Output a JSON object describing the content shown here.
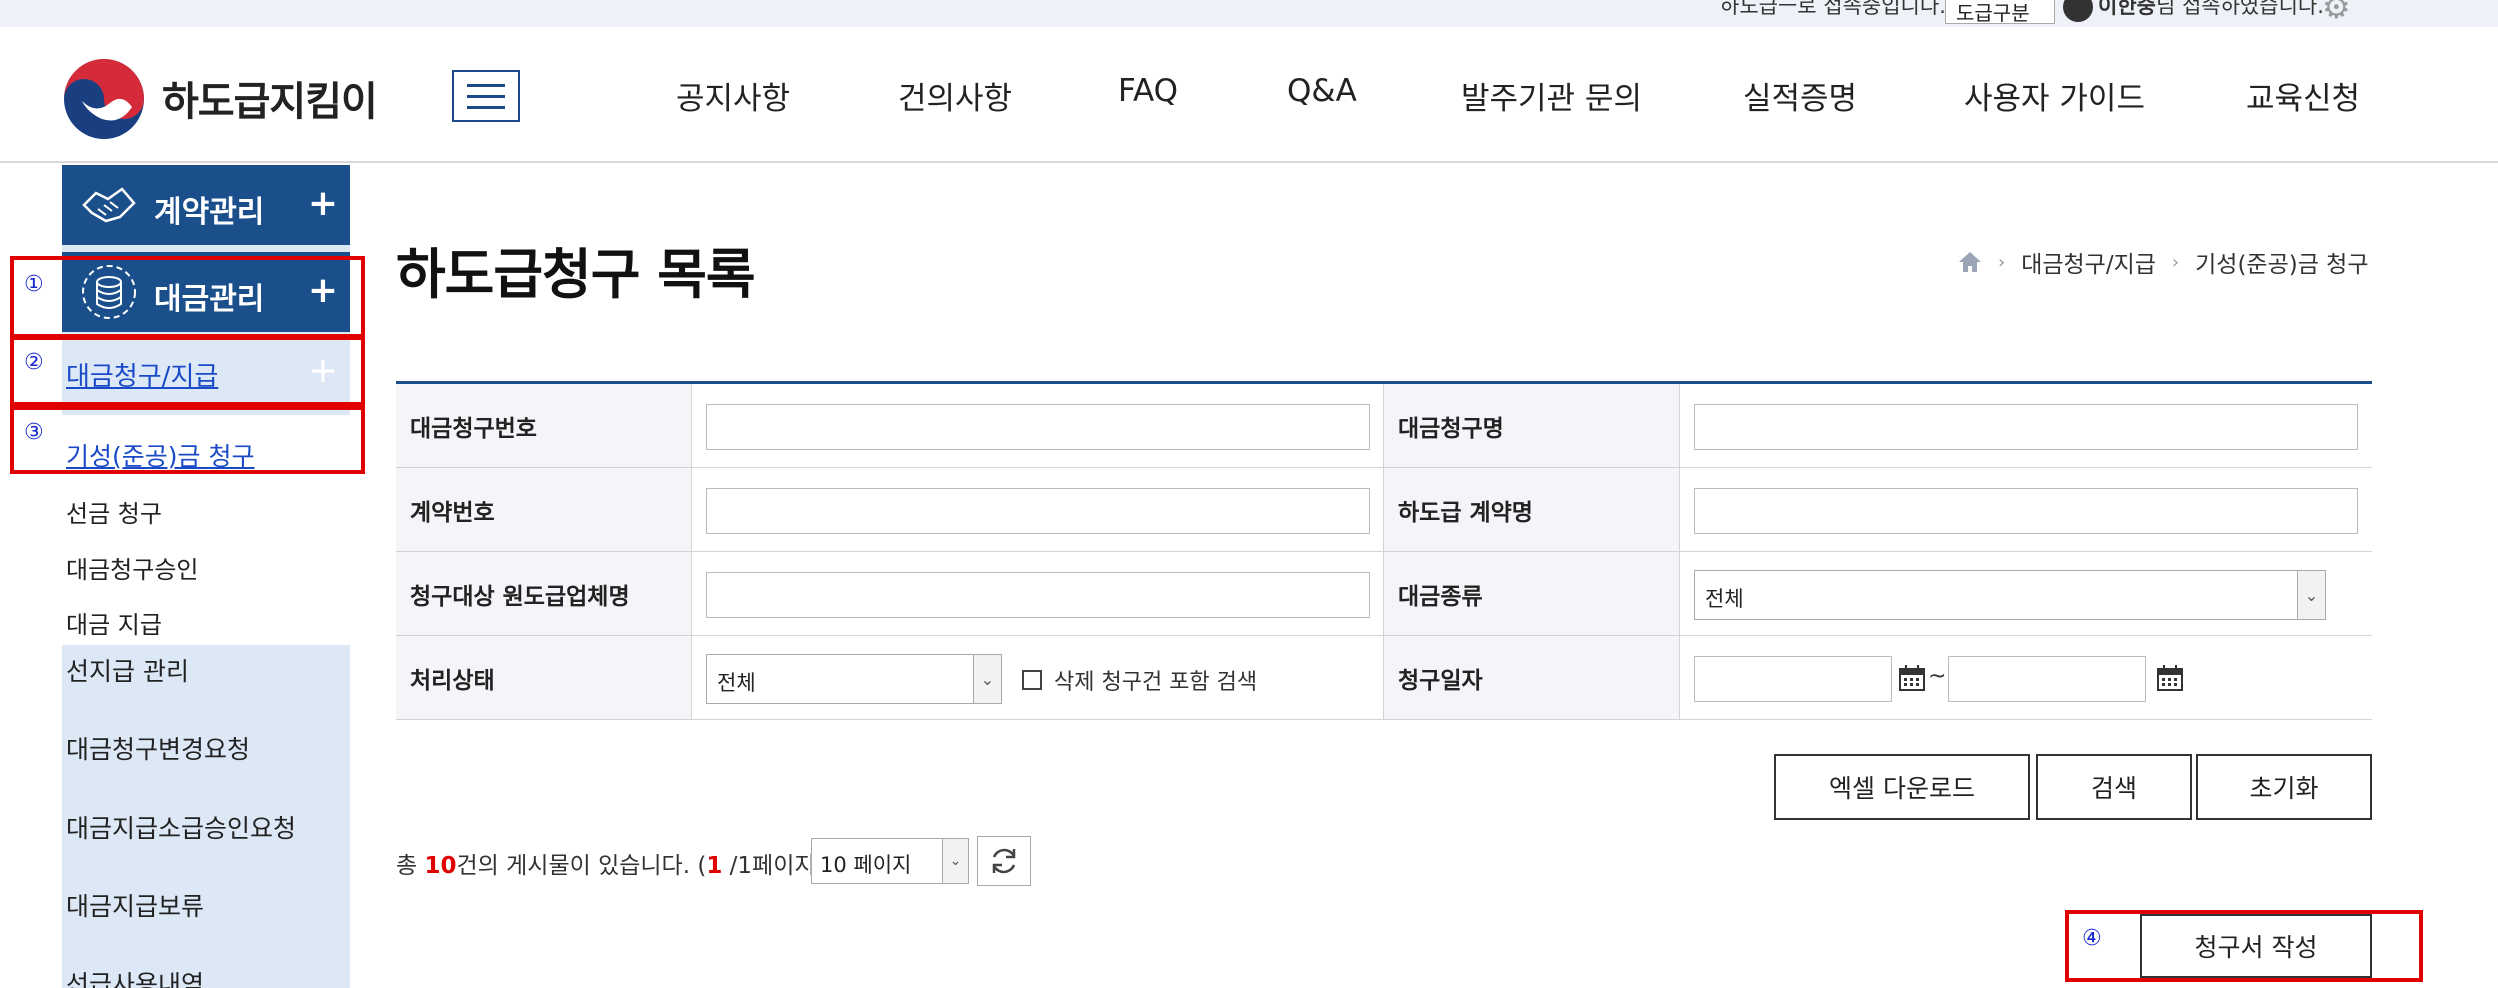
{
  "util_bar": {
    "text": "하도급ㅡ로 접속중입니다.",
    "select_value": "도급구분",
    "user_name": "이한중",
    "user_suffix": "님 접속하였습니다."
  },
  "header": {
    "logo_text": "하도급지킴이",
    "nav": [
      "공지사항",
      "건의사항",
      "FAQ",
      "Q&A",
      "발주기관 문의",
      "실적증명",
      "사용자 가이드",
      "교육신청"
    ]
  },
  "sidebar": {
    "main1": "계약관리",
    "main2": "대금관리",
    "sub": "대금청구/지급",
    "third": [
      "기성(준공)금 청구",
      "선금 청구",
      "대금청구승인",
      "대금 지급"
    ],
    "items": [
      "선지급 관리",
      "대금청구변경요청",
      "대금지급소급승인요청",
      "대금지급보류",
      "선급사용내역"
    ],
    "plus": "+"
  },
  "annotations": [
    "①",
    "②",
    "③",
    "④"
  ],
  "page": {
    "title": "하도급청구 목록",
    "breadcrumb": [
      "대금청구/지급",
      "기성(준공)금 청구"
    ]
  },
  "search": {
    "labels": {
      "claim_no": "대금청구번호",
      "claim_name": "대금청구명",
      "contract_no": "계약번호",
      "sub_contract_name": "하도급 계약명",
      "prime_company": "청구대상 원도급업체명",
      "payment_type": "대금종류",
      "status": "처리상태",
      "claim_date": "청구일자"
    },
    "payment_type_value": "전체",
    "status_value": "전체",
    "include_deleted": "삭제 청구건 포함 검색",
    "date_sep": "~"
  },
  "buttons": {
    "excel": "엑셀 다운로드",
    "search": "검색",
    "reset": "초기화",
    "write": "청구서 작성"
  },
  "list": {
    "count_prefix": "총 ",
    "count": "10",
    "count_suffix": "건의 게시물이 있습니다. (",
    "page_current": "1",
    "page_suffix": " /1페이지)",
    "per_page": "10 페이지"
  }
}
